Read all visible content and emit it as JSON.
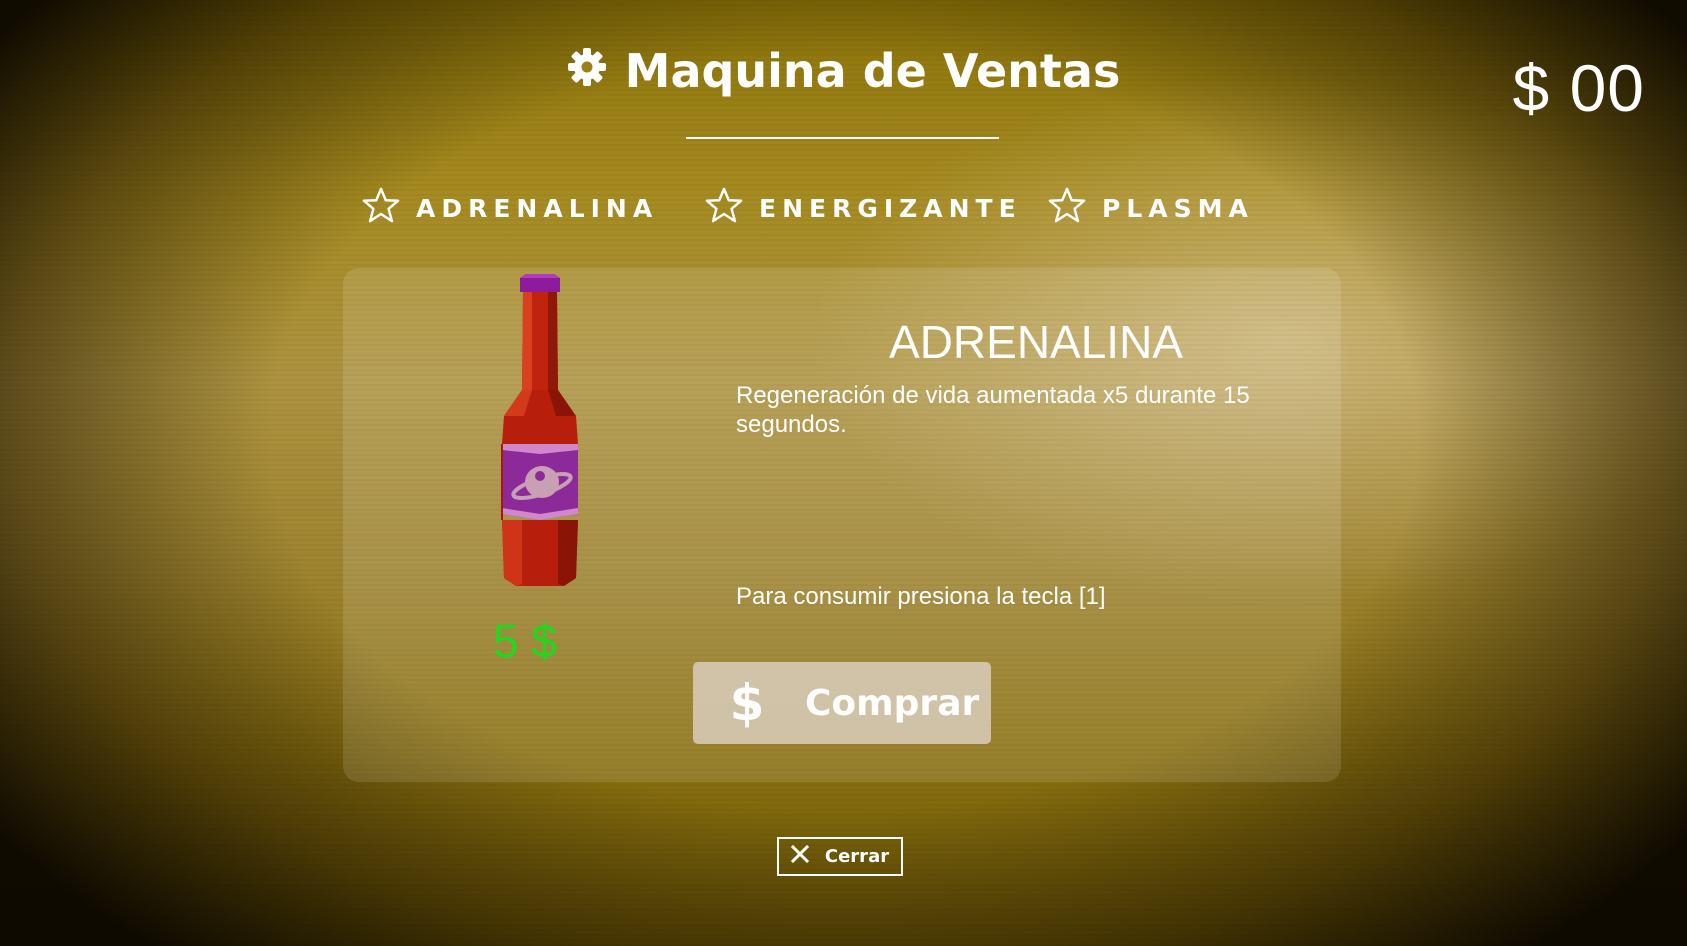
{
  "header": {
    "title": "Maquina de Ventas",
    "title_icon": "gear-icon",
    "money": "$ 00"
  },
  "tabs": [
    {
      "label": "ADRENALINA",
      "icon": "star-outline-icon"
    },
    {
      "label": "ENERGIZANTE",
      "icon": "star-outline-icon"
    },
    {
      "label": "PLASMA",
      "icon": "star-outline-icon"
    }
  ],
  "item": {
    "name": "ADRENALINA",
    "description": "Regeneración de vida aumentada x5 durante 15 segundos.",
    "hint": "Para consumir presiona la tecla [1]",
    "price": "5 $",
    "image": "red-bottle-with-purple-label"
  },
  "buy_button": {
    "icon": "$",
    "label": "Comprar"
  },
  "close_button": {
    "label": "Cerrar",
    "icon": "close-icon"
  },
  "colors": {
    "price": "#1ed91e",
    "text": "#ffffff",
    "background": "#a58a20"
  }
}
